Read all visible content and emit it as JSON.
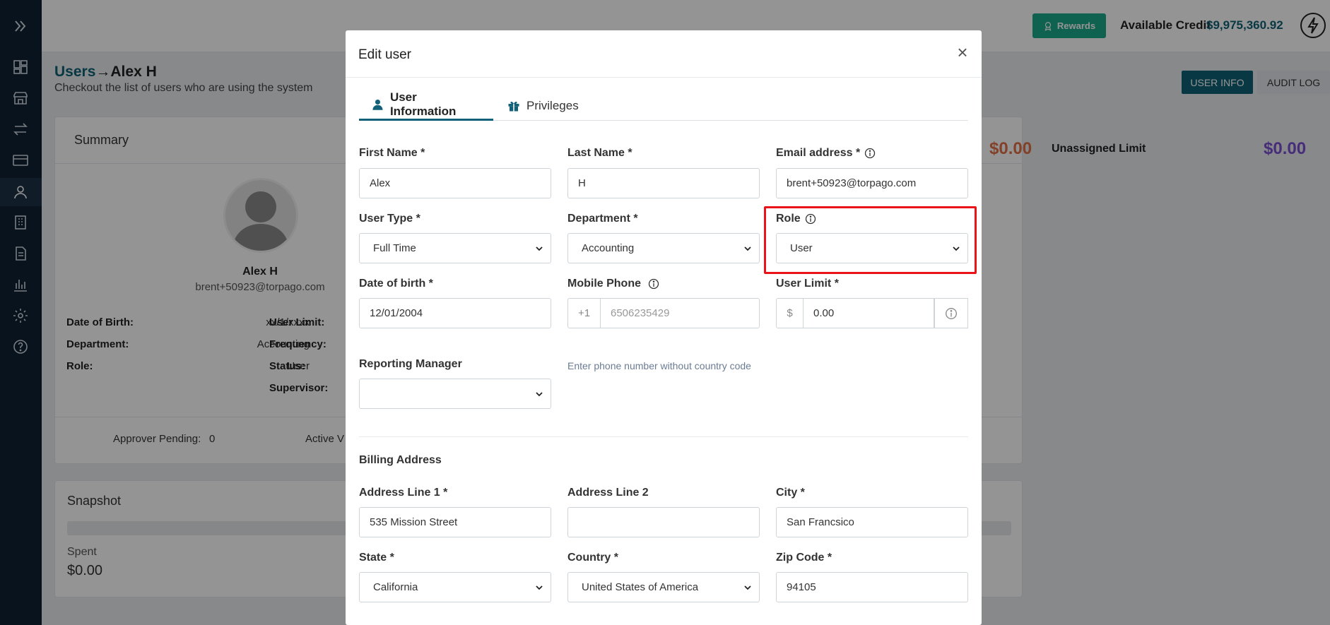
{
  "header": {
    "rewards_label": "Rewards",
    "available_credit_label": "Available Credit",
    "available_credit_value": "$9,975,360.92"
  },
  "sidebar": {
    "items": [
      "expand",
      "dashboard",
      "store",
      "transfers",
      "cards",
      "users",
      "company",
      "documents",
      "reports",
      "settings",
      "help"
    ]
  },
  "page": {
    "breadcrumb_parent": "Users",
    "breadcrumb_arrow": "→",
    "breadcrumb_current": "Alex H",
    "subtitle": "Checkout the list of users who are using the system",
    "tabs": {
      "user_info": "USER INFO",
      "audit_log": "AUDIT LOG"
    }
  },
  "summary": {
    "title": "Summary",
    "name": "Alex H",
    "email": "brent+50923@torpago.com",
    "dob_label": "Date of Birth:",
    "dob_value": "xx/1/xxxx",
    "department_label": "Department:",
    "department_value": "Accounting",
    "role_label": "Role:",
    "role_value": "User",
    "user_limit_label": "User Limit:",
    "frequency_label": "Frequency:",
    "status_label": "Status:",
    "supervisor_label": "Supervisor:",
    "approver_pending_label": "Approver Pending:",
    "approver_pending_value": "0",
    "active_label": "Active V",
    "limit_value": "$0.00",
    "unassigned_limit_label": "Unassigned Limit",
    "unassigned_limit_value": "$0.00"
  },
  "snapshot": {
    "title": "Snapshot",
    "spent_label": "Spent",
    "spent_value": "$0.00"
  },
  "modal": {
    "title": "Edit user",
    "close": "×",
    "tabs": {
      "user_information": "User Information",
      "privileges": "Privileges"
    },
    "fields": {
      "first_name": {
        "label": "First Name *",
        "value": "Alex"
      },
      "last_name": {
        "label": "Last Name *",
        "value": "H"
      },
      "email": {
        "label": "Email address *",
        "value": "brent+50923@torpago.com"
      },
      "user_type": {
        "label": "User Type *",
        "value": "Full Time"
      },
      "department": {
        "label": "Department *",
        "value": "Accounting"
      },
      "role": {
        "label": "Role",
        "value": "User"
      },
      "dob": {
        "label": "Date of birth *",
        "value": "12/01/2004"
      },
      "mobile_phone": {
        "label": "Mobile Phone",
        "prefix": "+1",
        "value": "6506235429",
        "helper": "Enter phone number without country code"
      },
      "user_limit": {
        "label": "User Limit *",
        "prefix": "$",
        "value": "0.00"
      },
      "reporting_manager": {
        "label": "Reporting Manager",
        "value": ""
      }
    },
    "billing": {
      "title": "Billing Address",
      "address1": {
        "label": "Address Line 1 *",
        "value": "535 Mission Street"
      },
      "address2": {
        "label": "Address Line 2",
        "value": ""
      },
      "city": {
        "label": "City *",
        "value": "San Francsico"
      },
      "state": {
        "label": "State *",
        "value": "California"
      },
      "country": {
        "label": "Country *",
        "value": "United States of America"
      },
      "zip": {
        "label": "Zip Code *",
        "value": "94105"
      }
    }
  },
  "colors": {
    "primary": "#116178",
    "sidebar": "#0f2233",
    "rewards": "#1aaa8a",
    "highlight": "#e8141a",
    "limit": "#e07046",
    "unassigned": "#7a4fd1"
  }
}
